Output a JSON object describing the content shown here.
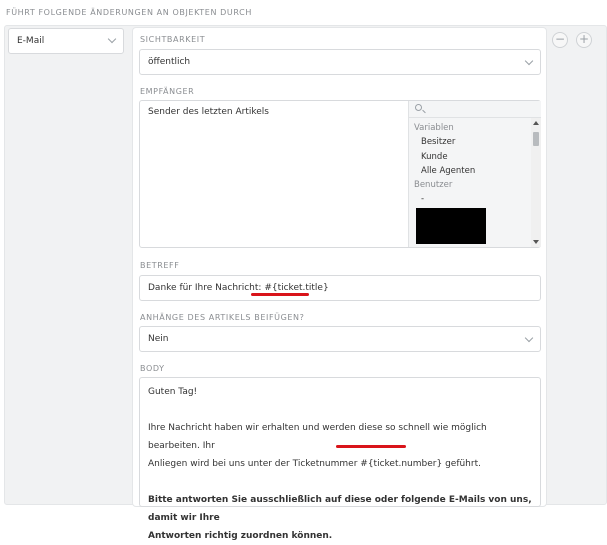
{
  "section": {
    "title": "FÜHRT FOLGENDE ÄNDERUNGEN AN OBJEKTEN DURCH"
  },
  "action": {
    "type": "E-Mail"
  },
  "visibility": {
    "label": "SICHTBARKEIT",
    "value": "öffentlich"
  },
  "recipient": {
    "label": "EMPFÄNGER",
    "selected": "Sender des letzten Artikels",
    "groups": [
      {
        "name": "Variablen",
        "options": [
          "Besitzer",
          "Kunde",
          "Alle Agenten"
        ]
      },
      {
        "name": "Benutzer",
        "options": [
          "-"
        ]
      }
    ]
  },
  "subject": {
    "label": "BETREFF",
    "prefix": "Danke für Ihre Nachricht: ",
    "variable": "#{ticket.title}"
  },
  "attachments": {
    "label": "ANHÄNGE DES ARTIKELS BEIFÜGEN?",
    "value": "Nein"
  },
  "body": {
    "label": "BODY",
    "greeting": "Guten Tag!",
    "para1_a": "Ihre Nachricht haben wir erhalten und werden diese so schnell wie möglich bearbeiten. Ihr",
    "para1_b": "Anliegen wird bei uns unter der Ticketnummer ",
    "para1_var": "#{ticket.number}",
    "para1_c": " geführt.",
    "para2_a": "Bitte antworten Sie ausschließlich auf diese oder folgende E-Mails von uns, damit wir Ihre",
    "para2_b": "Antworten richtig zuordnen können."
  },
  "controls": {
    "remove": "−",
    "add": "+"
  },
  "icons": {
    "search": "search-icon",
    "chevron": "chevron-down-icon"
  },
  "colors": {
    "highlight": "#d9141a",
    "label": "#8a8d91"
  }
}
